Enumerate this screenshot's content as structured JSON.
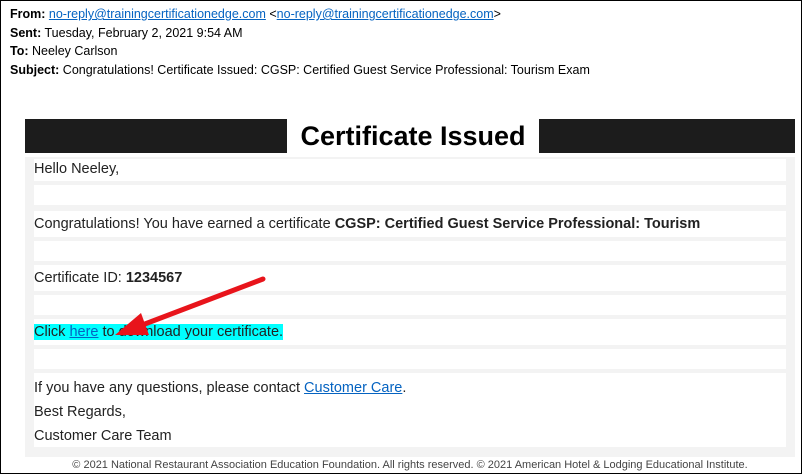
{
  "header": {
    "from_label": "From:",
    "from_address": "no-reply@trainingcertificationedge.com",
    "from_address_bracketed": "<no-reply@trainingcertificationedge.com>",
    "bracket_open": "<",
    "bracket_close": ">",
    "sent_label": "Sent:",
    "sent_value": "Tuesday, February 2, 2021 9:54 AM",
    "to_label": "To:",
    "to_value": "Neeley Carlson",
    "subject_label": "Subject:",
    "subject_value": "Congratulations! Certificate Issued: CGSP: Certified Guest Service Professional: Tourism Exam"
  },
  "banner": {
    "title": "Certificate Issued"
  },
  "body": {
    "greeting": "Hello Neeley,",
    "congrats_prefix": "Congratulations! You have earned a certificate ",
    "certificate_name": "CGSP: Certified Guest Service Professional: Tourism",
    "cert_id_label": "Certificate ID: ",
    "cert_id_value": "1234567",
    "click_prefix": "Click ",
    "click_link": "here",
    "click_suffix": " to download your certificate.",
    "questions_prefix": "If you have any questions, please contact ",
    "questions_link": "Customer Care",
    "questions_suffix": ".",
    "regards": "Best Regards,",
    "signature": "Customer Care Team"
  },
  "footer": {
    "text": "© 2021 National Restaurant Association Education Foundation. All rights reserved. © 2021 American Hotel & Lodging Educational Institute."
  },
  "colors": {
    "link": "#0563c1",
    "highlight": "#00ffff",
    "banner": "#1c1c1c",
    "arrow": "#e8141b"
  }
}
